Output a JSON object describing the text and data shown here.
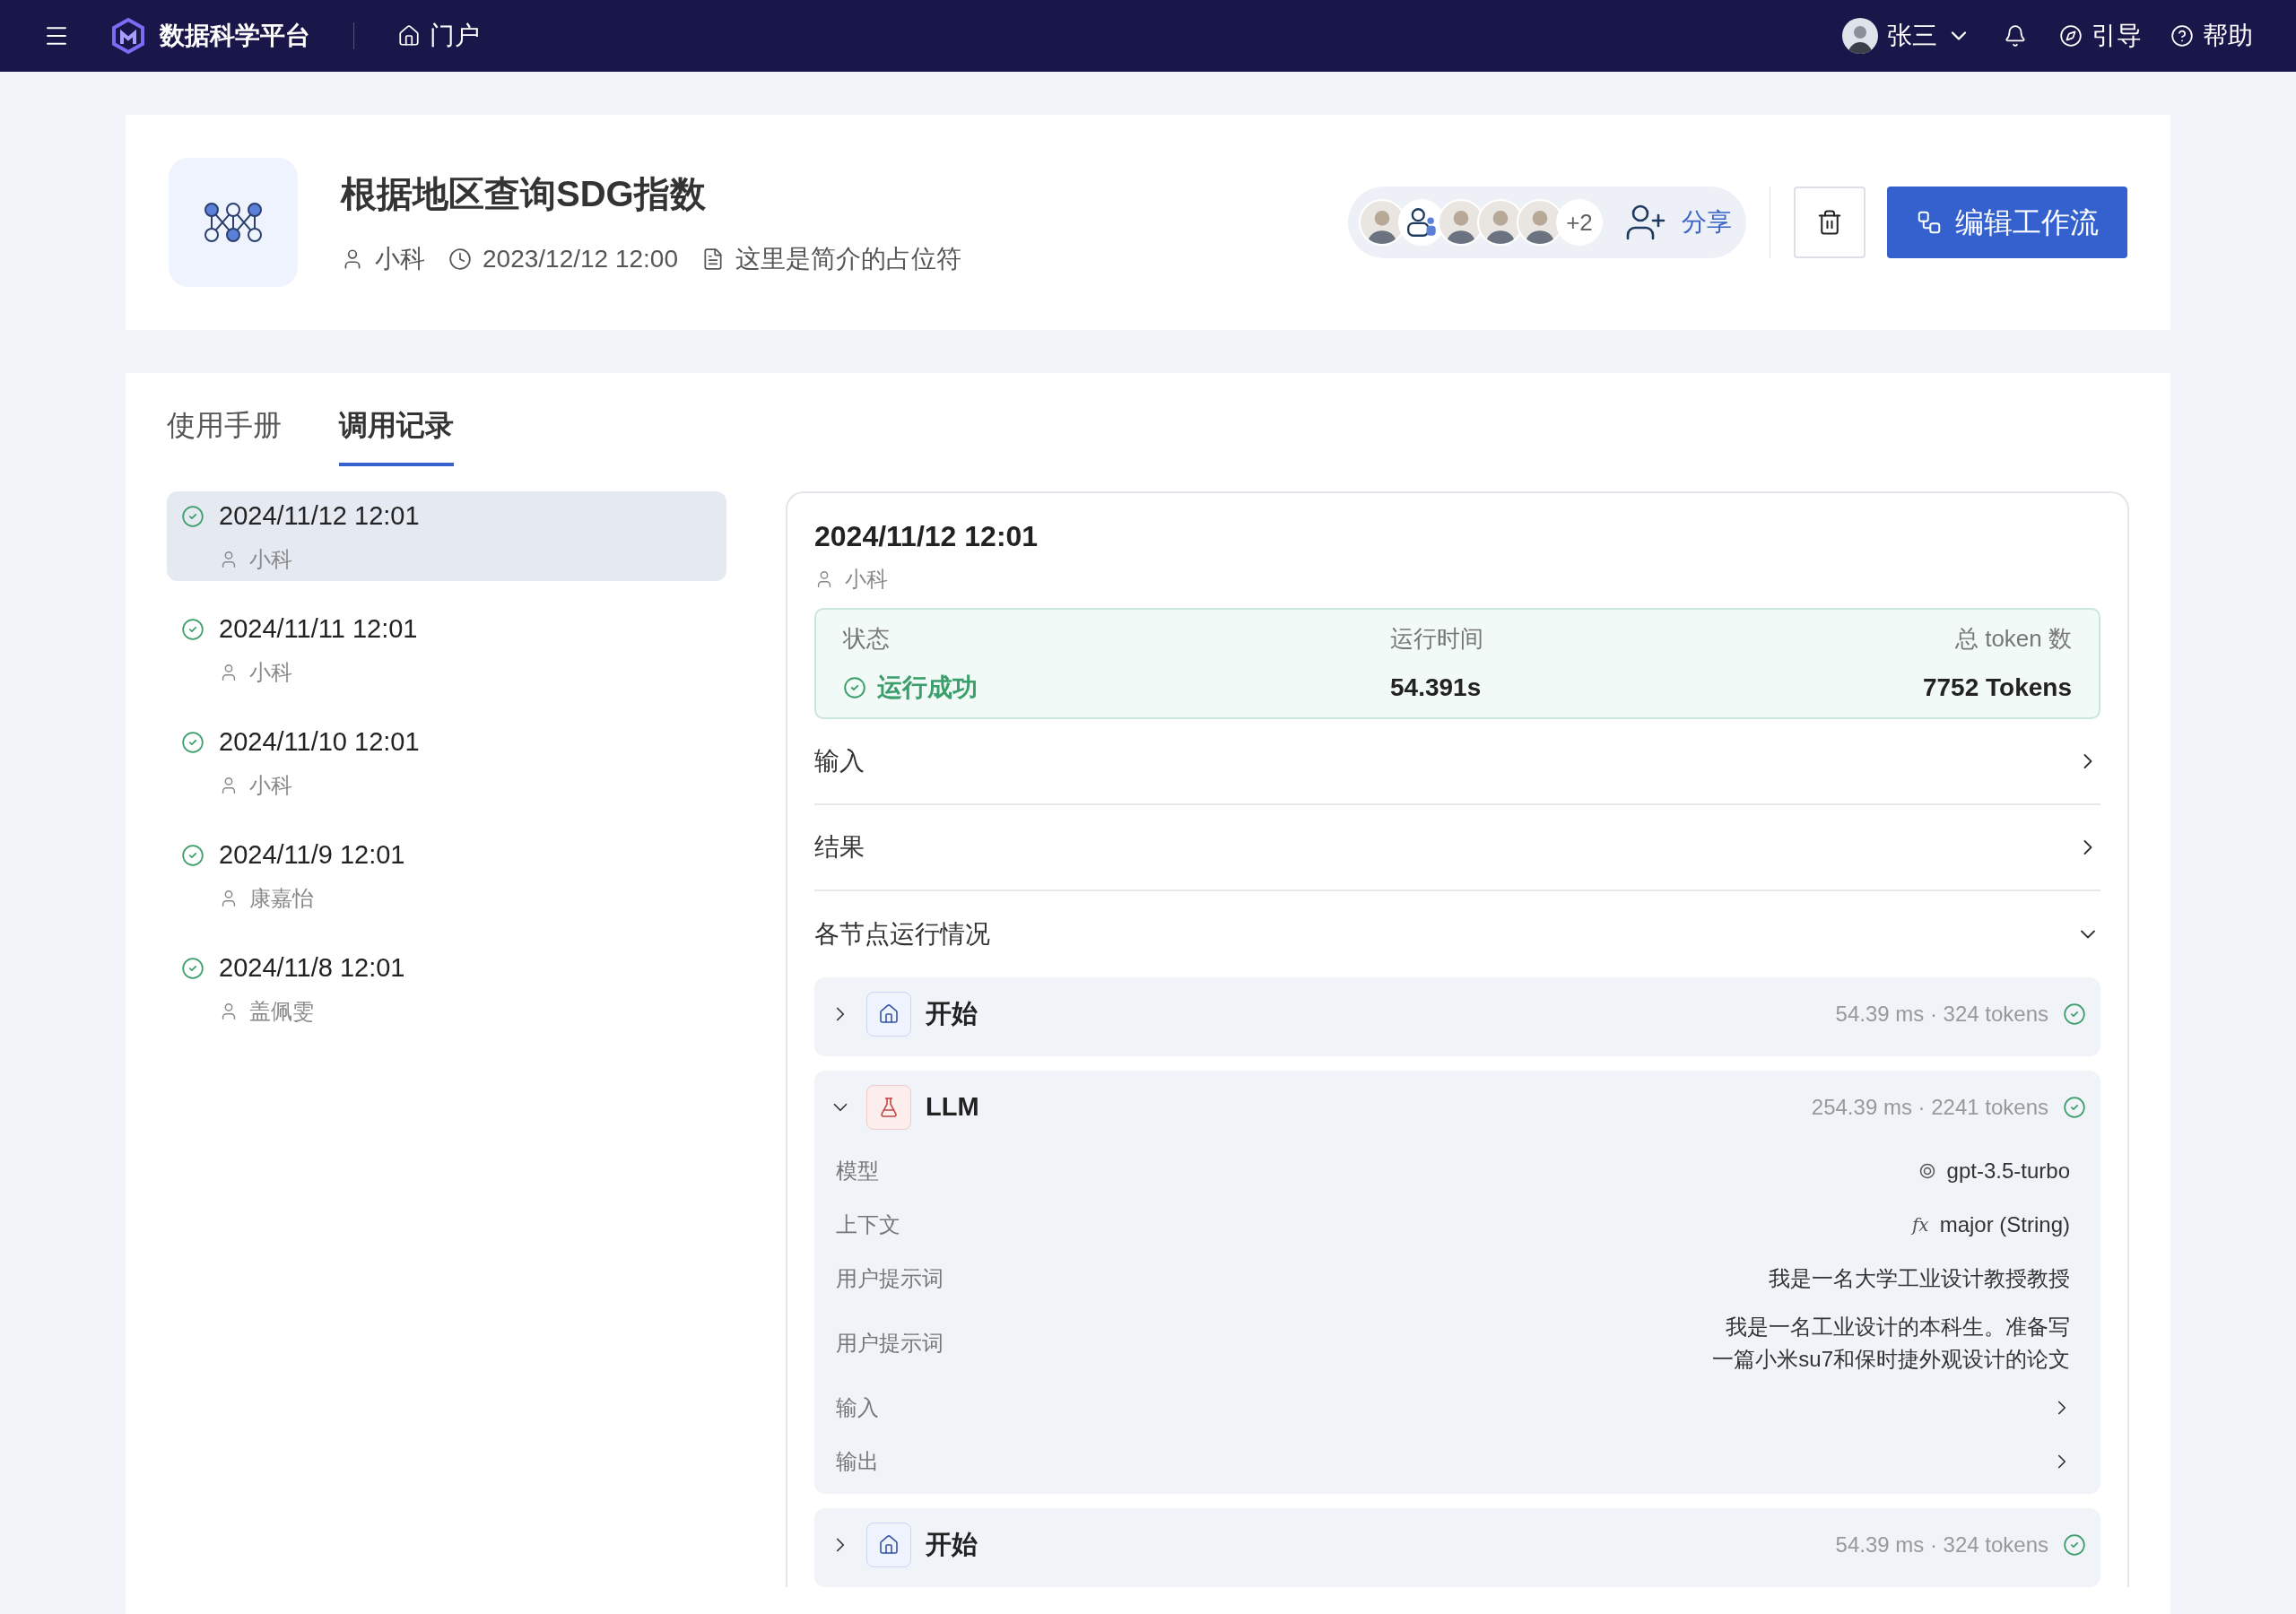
{
  "topbar": {
    "app_name": "数据科学平台",
    "nav_link": "门户",
    "user": "张三",
    "guide": "引导",
    "help": "帮助"
  },
  "workflow": {
    "title": "根据地区查询SDG指数",
    "author": "小科",
    "time": "2023/12/12 12:00",
    "description": "这里是简介的占位符",
    "avatars": [
      {
        "kind": "photo"
      },
      {
        "kind": "group"
      },
      {
        "kind": "photo"
      },
      {
        "kind": "photo"
      },
      {
        "kind": "photo"
      }
    ],
    "more_count": "+2",
    "share": "分享",
    "edit": "编辑工作流"
  },
  "tabs": [
    {
      "label": "使用手册",
      "selected": false
    },
    {
      "label": "调用记录",
      "selected": true
    }
  ],
  "records": [
    {
      "time": "2024/11/12 12:01",
      "user": "小科",
      "selected": true
    },
    {
      "time": "2024/11/11 12:01",
      "user": "小科",
      "selected": false
    },
    {
      "time": "2024/11/10 12:01",
      "user": "小科",
      "selected": false
    },
    {
      "time": "2024/11/9 12:01",
      "user": "康嘉怡",
      "selected": false
    },
    {
      "time": "2024/11/8 12:01",
      "user": "盖佩雯",
      "selected": false
    }
  ],
  "detail": {
    "time": "2024/11/12 12:01",
    "user": "小科",
    "summary": {
      "status_label": "状态",
      "status": "运行成功",
      "duration_label": "运行时间",
      "duration": "54.391s",
      "tokens_label": "总 token 数",
      "tokens": "7752 Tokens"
    },
    "sections": [
      {
        "label": "输入",
        "expanded": false
      },
      {
        "label": "结果",
        "expanded": false
      },
      {
        "label": "各节点运行情况",
        "expanded": true
      }
    ],
    "nodes": [
      {
        "kind": "home",
        "name": "开始",
        "stats": "54.39 ms · 324 tokens",
        "expanded": false
      },
      {
        "kind": "flask",
        "name": "LLM",
        "stats": "254.39 ms · 2241 tokens",
        "expanded": true,
        "fields": [
          {
            "kind": "model",
            "label": "模型",
            "lines": [
              "gpt-3.5-turbo"
            ]
          },
          {
            "kind": "formula",
            "label": "上下文",
            "prefix": "fx",
            "lines": [
              "major (String)"
            ]
          },
          {
            "kind": "text",
            "label": "用户提示词",
            "lines": [
              "我是一名大学工业设计教授教授"
            ]
          },
          {
            "kind": "text",
            "label": "用户提示词",
            "lines": [
              "我是一名工业设计的本科生。准备写",
              "一篇小米su7和保时捷外观设计的论文"
            ]
          },
          {
            "kind": "link",
            "label": "输入"
          },
          {
            "kind": "link",
            "label": "输出"
          }
        ]
      },
      {
        "kind": "home",
        "name": "开始",
        "stats": "54.39 ms · 324 tokens",
        "expanded": false
      }
    ]
  }
}
